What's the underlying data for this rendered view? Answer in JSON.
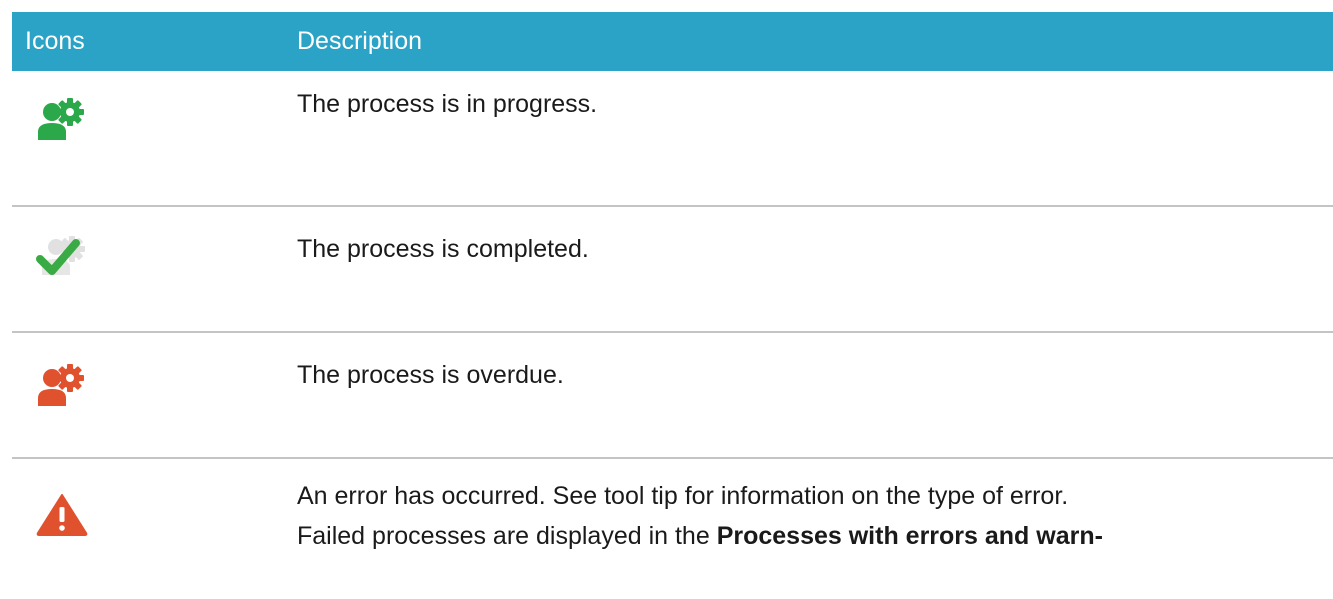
{
  "table": {
    "headers": {
      "icons": "Icons",
      "description": "Description"
    },
    "rows": [
      {
        "icon": "process-in-progress-icon",
        "color": "#2aa84a",
        "text": "The process is in progress."
      },
      {
        "icon": "process-completed-icon",
        "color": "#3aaa44",
        "text": "The process is completed."
      },
      {
        "icon": "process-overdue-icon",
        "color": "#e0512e",
        "text": "The process is overdue."
      },
      {
        "icon": "error-warning-icon",
        "color": "#e0512e",
        "line1": "An error has occurred. See tool tip for information on the type of error.",
        "line2_prefix": "Failed processes are displayed in the ",
        "line2_bold": "Processes with errors and warn-"
      }
    ]
  },
  "colors": {
    "header_bg": "#2ba3c6",
    "divider": "#c4c4c4"
  }
}
